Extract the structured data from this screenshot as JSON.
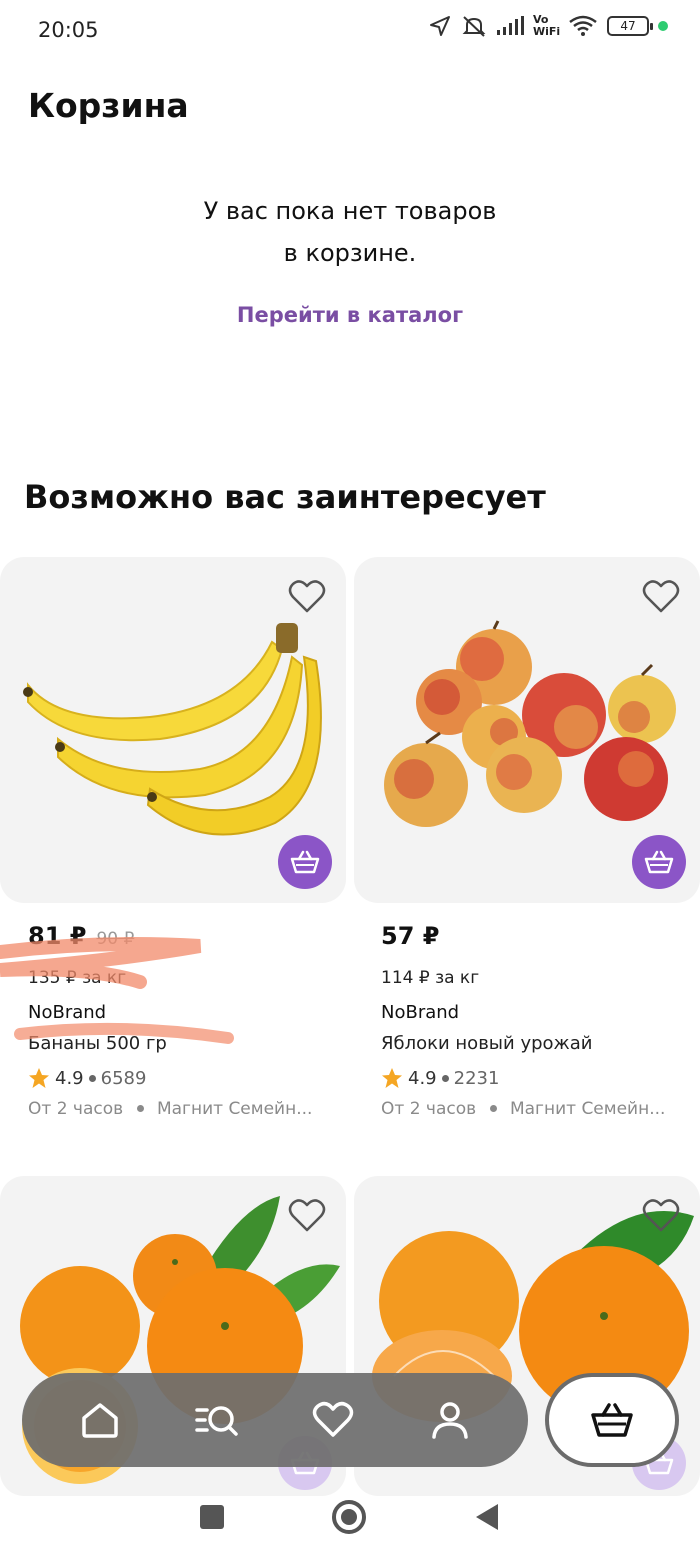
{
  "status_bar": {
    "time": "20:05",
    "battery": "47",
    "network_label": "Vo WiFi"
  },
  "header": {
    "title": "Корзина"
  },
  "empty_cart": {
    "line1": "У вас пока нет товаров",
    "line2": "в корзине.",
    "catalog_link": "Перейти в каталог"
  },
  "recommendations": {
    "title": "Возможно вас заинтересует",
    "products": [
      {
        "price": "81 ₽",
        "old_price": "90 ₽",
        "price_per_kg": "135 ₽ за кг",
        "brand": "NoBrand",
        "name": "Бананы 500 гр",
        "rating": "4.9",
        "reviews": "6589",
        "delivery": "От 2 часов",
        "store": "Магнит Семейн...",
        "image": "bananas"
      },
      {
        "price": "57 ₽",
        "old_price": "",
        "price_per_kg": "114 ₽ за кг",
        "brand": "NoBrand",
        "name": "Яблоки новый урожай",
        "rating": "4.9",
        "reviews": "2231",
        "delivery": "От 2 часов",
        "store": "Магнит Семейн...",
        "image": "apples"
      },
      {
        "image": "oranges"
      },
      {
        "image": "tangerines"
      }
    ]
  },
  "bottom_nav": {
    "items": [
      "home-icon",
      "catalog-search-icon",
      "favorites-icon",
      "profile-icon"
    ],
    "active": "cart-icon"
  },
  "colors": {
    "accent": "#7a4ea3",
    "cart_button": "#8b55c7",
    "nav_bg": "#6e6e6e",
    "star": "#f5a623"
  }
}
